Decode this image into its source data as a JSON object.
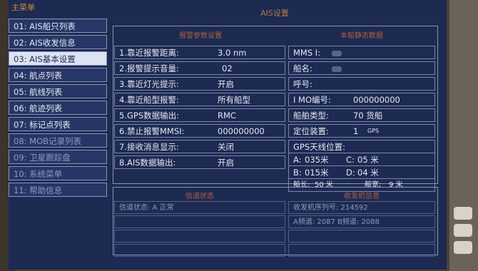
{
  "menu": {
    "title": "主菜单",
    "items": [
      {
        "label": "01: AIS船只列表",
        "active": false
      },
      {
        "label": "02: AIS收发信息",
        "active": false
      },
      {
        "label": "03: AIS基本设置",
        "active": true
      },
      {
        "label": "04: 航点列表",
        "active": false
      },
      {
        "label": "05: 航线列表",
        "active": false
      },
      {
        "label": "06: 航迹列表",
        "active": false
      },
      {
        "label": "07: 标记点列表",
        "active": false
      },
      {
        "label": "08: MOB记录列表",
        "active": false
      },
      {
        "label": "09: 卫星跟踪盘",
        "active": false
      },
      {
        "label": "10: 系统菜单",
        "active": false
      },
      {
        "label": "11: 帮助信息",
        "active": false
      }
    ]
  },
  "main": {
    "title": "AIS设置",
    "left_header": "报警参数设置",
    "right_header": "本船静态数据",
    "settings": [
      {
        "label": "1.靠近报警距离:",
        "value": "3.0 nm"
      },
      {
        "label": "2.报警提示音量:",
        "value": "02"
      },
      {
        "label": "3.靠近灯光提示:",
        "value": "开启"
      },
      {
        "label": "4.靠近船型报警:",
        "value": "所有船型"
      },
      {
        "label": "5.GPS数据输出:",
        "value": "RMC"
      },
      {
        "label": "6.禁止报警MMSI:",
        "value": "000000000"
      },
      {
        "label": "7.接收消息显示:",
        "value": "关闭"
      },
      {
        "label": "8.AIS数据输出:",
        "value": "开启"
      }
    ],
    "ship": {
      "mmsi_label": "MMS I:",
      "name_label": "船名:",
      "callsign_label": "呼号:",
      "imo_label": "I MO编号:",
      "imo_value": "000000000",
      "type_label": "船舶类型:",
      "type_value": "70  货船",
      "locator_label": "定位装置:",
      "locator_value": "1",
      "locator_unit": "GPS",
      "gps_pos_label": "GPS天线位置:",
      "a_label": "A:",
      "a_value": "035米",
      "c_label": "C:",
      "c_value": "05 米",
      "b_label": "B:",
      "b_value": "015米",
      "d_label": "D:",
      "d_value": "04 米",
      "len_label": "船长:",
      "len_value": "50 米",
      "width_label": "船宽:",
      "width_value": "9 米"
    },
    "low_left_header": "信道状态",
    "low_right_header": "收发机信息",
    "low_left_rows": [
      "信道状态: A  正常"
    ],
    "low_right_rows": [
      "收发机序列号: 214592",
      "A频道: 2087  B频道: 2088"
    ]
  }
}
